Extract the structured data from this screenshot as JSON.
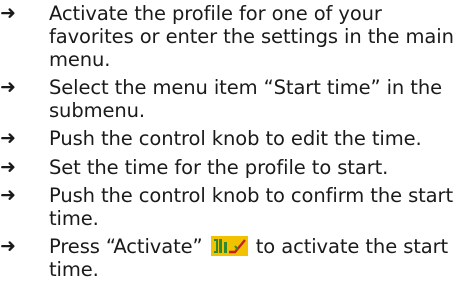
{
  "instructions": {
    "arrow_glyph": "➜",
    "steps": [
      {
        "text": "Activate the profile for one of your favorites or enter the settings in the main menu."
      },
      {
        "text": "Select the menu item “Start time” in the submenu."
      },
      {
        "text": "Push the control knob to edit the time."
      },
      {
        "text": "Set the time for the profile to start."
      },
      {
        "text": "Push the control knob to confirm the start time."
      },
      {
        "text_before": "Press “Activate”",
        "icon": "activate-icon",
        "text_after": "to activate the start time."
      }
    ]
  },
  "colors": {
    "text": "#1a1a1a",
    "icon_background": "#f2c200",
    "icon_glyph_green": "#2f8a2f",
    "icon_glyph_red": "#c42020"
  }
}
